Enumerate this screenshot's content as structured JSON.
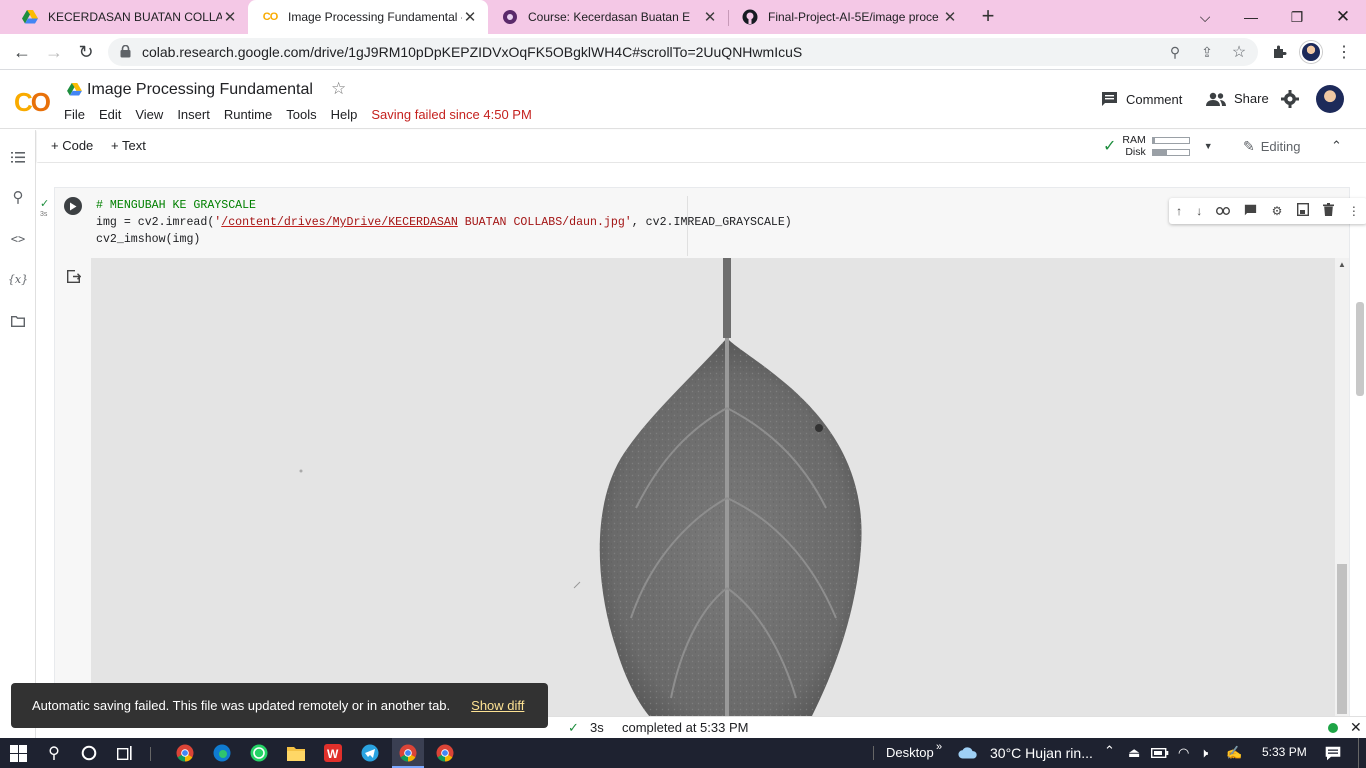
{
  "browser": {
    "tabs": [
      {
        "title": "KECERDASAN BUATAN COLLABS",
        "icon": "google-drive-icon"
      },
      {
        "title": "Image Processing Fundamental -",
        "icon": "colab-icon",
        "active": true
      },
      {
        "title": "Course: Kecerdasan Buatan E",
        "icon": "moodle-icon"
      },
      {
        "title": "Final-Project-AI-5E/image proce",
        "icon": "github-icon"
      }
    ],
    "url": "colab.research.google.com/drive/1gJ9RM10pDpKEPZIDVxOqFK5OBgklWH4C#scrollTo=2UuQNHwmIcuS"
  },
  "colab": {
    "title": "Image Processing Fundamental",
    "menu": [
      "File",
      "Edit",
      "View",
      "Insert",
      "Runtime",
      "Tools",
      "Help"
    ],
    "saving_status": "Saving failed since 4:50 PM",
    "comment_label": "Comment",
    "share_label": "Share",
    "add_code_label": "+ Code",
    "add_text_label": "+ Text",
    "ram_label": "RAM",
    "disk_label": "Disk",
    "ram_usage": 0.05,
    "disk_usage": 0.4,
    "editing_label": "Editing"
  },
  "cell": {
    "exec_time": "3s",
    "code_comment": "# MENGUBAH KE GRAYSCALE",
    "code_line2_pre": "img = cv2.imread(",
    "code_line2_str_a": "'",
    "code_line2_str_b": "/content/drives/MyDrive/KECERDASAN",
    "code_line2_str_c": " BUATAN COLLABS/daun.jpg'",
    "code_line2_post": ", cv2.IMREAD_GRAYSCALE)",
    "code_line3": "cv2_imshow(img)"
  },
  "status": {
    "check": "✓",
    "duration": "3s",
    "completed": "completed at 5:33 PM"
  },
  "toast": {
    "message": "Automatic saving failed. This file was updated remotely or in another tab.",
    "action": "Show diff"
  },
  "taskbar": {
    "desktop_label": "Desktop",
    "weather": "30°C  Hujan rin...",
    "time": "5:33 PM"
  }
}
